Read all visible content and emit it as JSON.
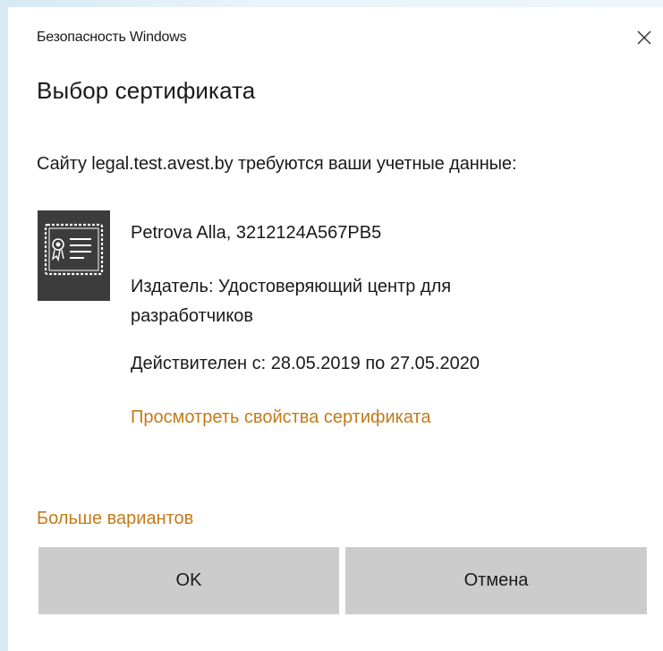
{
  "window": {
    "title": "Безопасность Windows"
  },
  "dialog": {
    "heading": "Выбор сертификата",
    "prompt": "Сайту legal.test.avest.by требуются ваши учетные данные:"
  },
  "certificate": {
    "icon": "certificate-icon",
    "name": "Petrova Alla, 3212124A567PB5",
    "issuer": "Издатель: Удостоверяющий центр для разработчиков",
    "validity": "Действителен с: 28.05.2019 по 27.05.2020",
    "properties_link": "Просмотреть свойства сертификата"
  },
  "more_options_link": "Больше вариантов",
  "buttons": {
    "ok_label": "OK",
    "cancel_label": "Отмена"
  },
  "colors": {
    "link": "#c37a1a",
    "button_bg": "#cccccc",
    "icon_bg": "#3c3c3c",
    "text": "#1a1a1a"
  }
}
